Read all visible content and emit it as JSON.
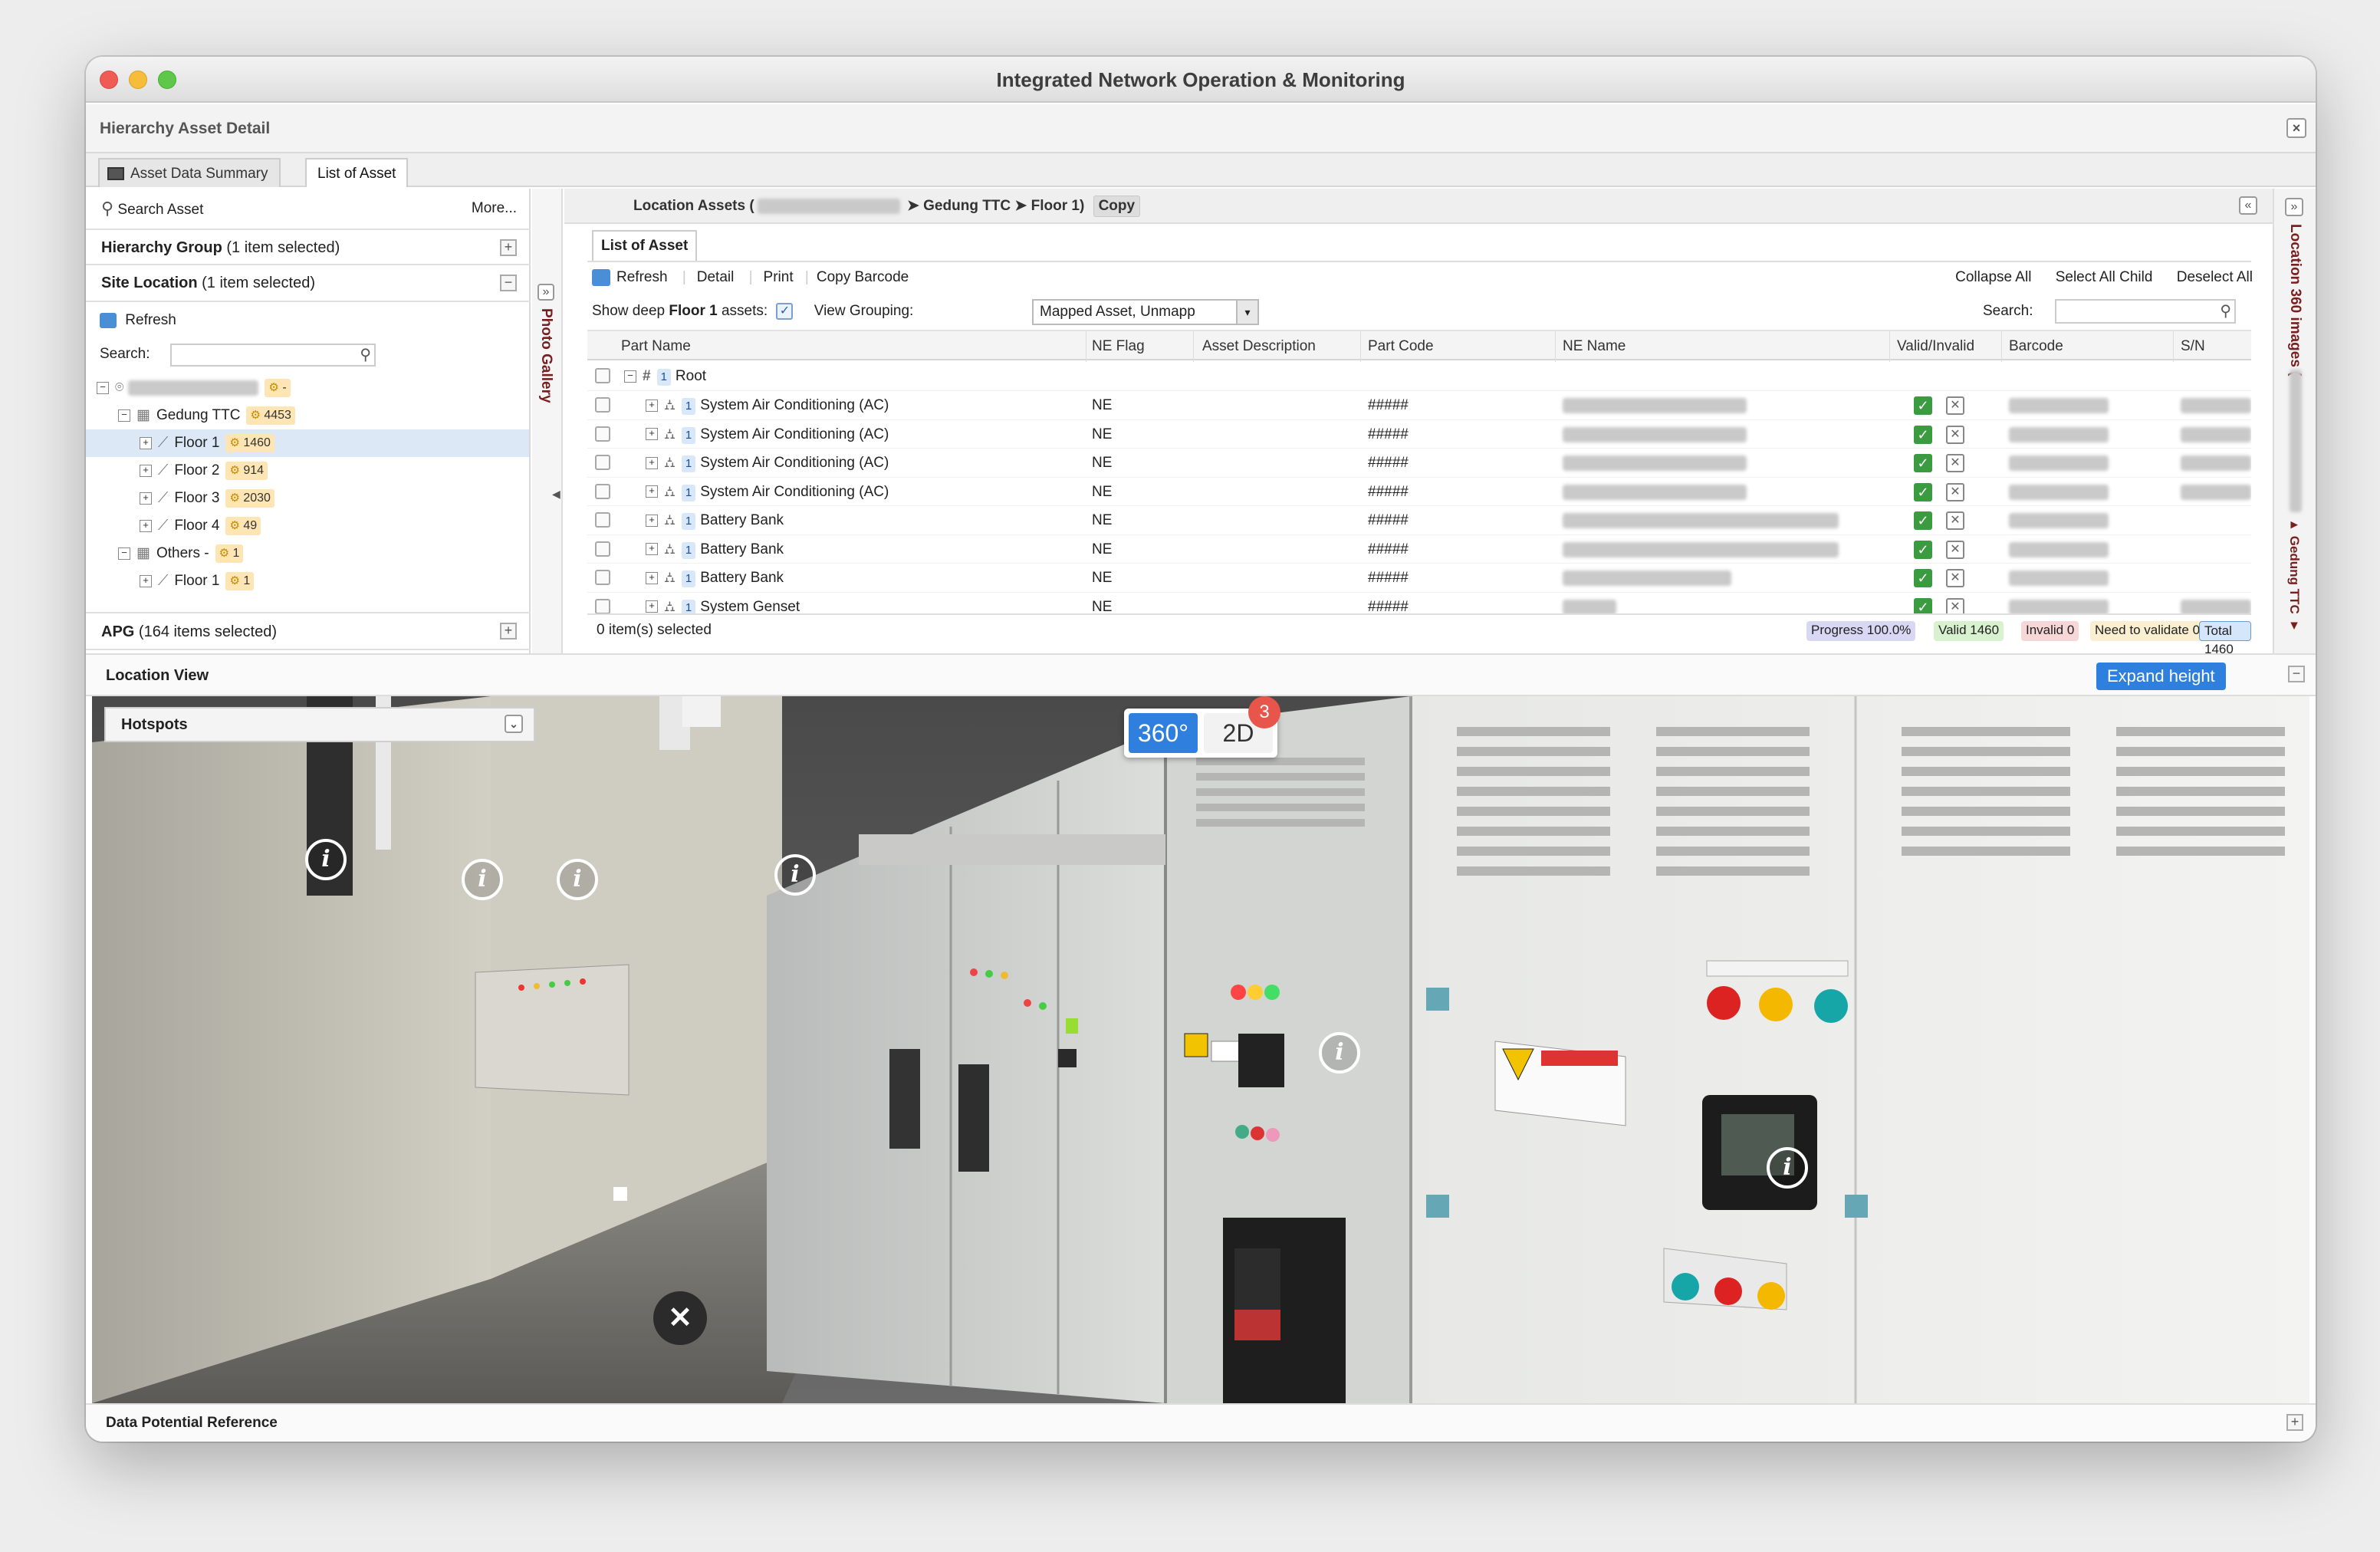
{
  "window": {
    "title": "Integrated Network Operation & Monitoring"
  },
  "panel": {
    "title": "Hierarchy Asset Detail"
  },
  "tabs": [
    {
      "label": "Asset Data Summary"
    },
    {
      "label": "List of Asset"
    }
  ],
  "left": {
    "search_label": "Search Asset",
    "more_label": "More...",
    "hierarchy_group": {
      "label": "Hierarchy Group",
      "note": "(1 item selected)"
    },
    "site_location": {
      "label": "Site Location",
      "note": "(1 item selected)"
    },
    "refresh_label": "Refresh",
    "search_field_label": "Search:",
    "tree": [
      {
        "label": "",
        "badge": "-"
      },
      {
        "label": "Gedung TTC",
        "badge": "4453"
      },
      {
        "label": "Floor 1",
        "badge": "1460"
      },
      {
        "label": "Floor 2",
        "badge": "914"
      },
      {
        "label": "Floor 3",
        "badge": "2030"
      },
      {
        "label": "Floor 4",
        "badge": "49"
      },
      {
        "label": "Others -",
        "badge": "1"
      },
      {
        "label": "Floor 1",
        "badge": "1"
      }
    ],
    "apg": {
      "label": "APG",
      "note": "(164 items selected)"
    }
  },
  "location_assets": {
    "prefix": "Location Assets (",
    "path": [
      "Gedung TTC",
      "Floor 1)"
    ],
    "copy_label": "Copy"
  },
  "photo_gallery_label": "Photo Gallery",
  "list": {
    "tab_label": "List of Asset",
    "toolbar": [
      "Refresh",
      "Detail",
      "Print",
      "Copy Barcode"
    ],
    "right_actions": [
      "Collapse All",
      "Select All Child",
      "Deselect All"
    ],
    "show_deep_prefix": "Show deep",
    "show_deep_floor": "Floor 1",
    "show_deep_suffix": "assets:",
    "view_grouping_label": "View Grouping:",
    "view_grouping_value": "Mapped Asset, Unmapp",
    "search_label": "Search:",
    "columns": [
      "Part Name",
      "NE Flag",
      "Asset Description",
      "Part Code",
      "NE Name",
      "Valid/Invalid",
      "Barcode",
      "S/N"
    ],
    "root": {
      "num": "1",
      "label": "Root"
    },
    "rows": [
      {
        "num": "1",
        "name": "System Air Conditioning (AC)",
        "flag": "NE",
        "code": "#####"
      },
      {
        "num": "1",
        "name": "System Air Conditioning (AC)",
        "flag": "NE",
        "code": "#####"
      },
      {
        "num": "1",
        "name": "System Air Conditioning (AC)",
        "flag": "NE",
        "code": "#####"
      },
      {
        "num": "1",
        "name": "System Air Conditioning (AC)",
        "flag": "NE",
        "code": "#####"
      },
      {
        "num": "1",
        "name": "Battery Bank",
        "flag": "NE",
        "code": "#####"
      },
      {
        "num": "1",
        "name": "Battery Bank",
        "flag": "NE",
        "code": "#####"
      },
      {
        "num": "1",
        "name": "Battery Bank",
        "flag": "NE",
        "code": "#####"
      },
      {
        "num": "1",
        "name": "System Genset",
        "flag": "NE",
        "code": "#####"
      }
    ],
    "selected_count": "0 item(s) selected",
    "status": {
      "progress": "Progress 100.0%",
      "valid": "Valid 1460",
      "invalid": "Invalid 0",
      "need": "Need to validate 0",
      "total": "Total 1460"
    }
  },
  "right_vertical": {
    "title": "Location 360 images (",
    "sub": "Gedung TTC"
  },
  "location_view": {
    "title": "Location View",
    "expand_label": "Expand height",
    "hotspots_label": "Hotspots",
    "toggle_360": "360°",
    "toggle_2d": "2D",
    "notif_count": "3"
  },
  "footer": {
    "label": "Data Potential Reference"
  },
  "colors": {
    "accent_blue": "#2f7fde",
    "valid_green": "#3a9b40",
    "notif_red": "#e8554a",
    "gallery_text": "#7a1f1f"
  }
}
